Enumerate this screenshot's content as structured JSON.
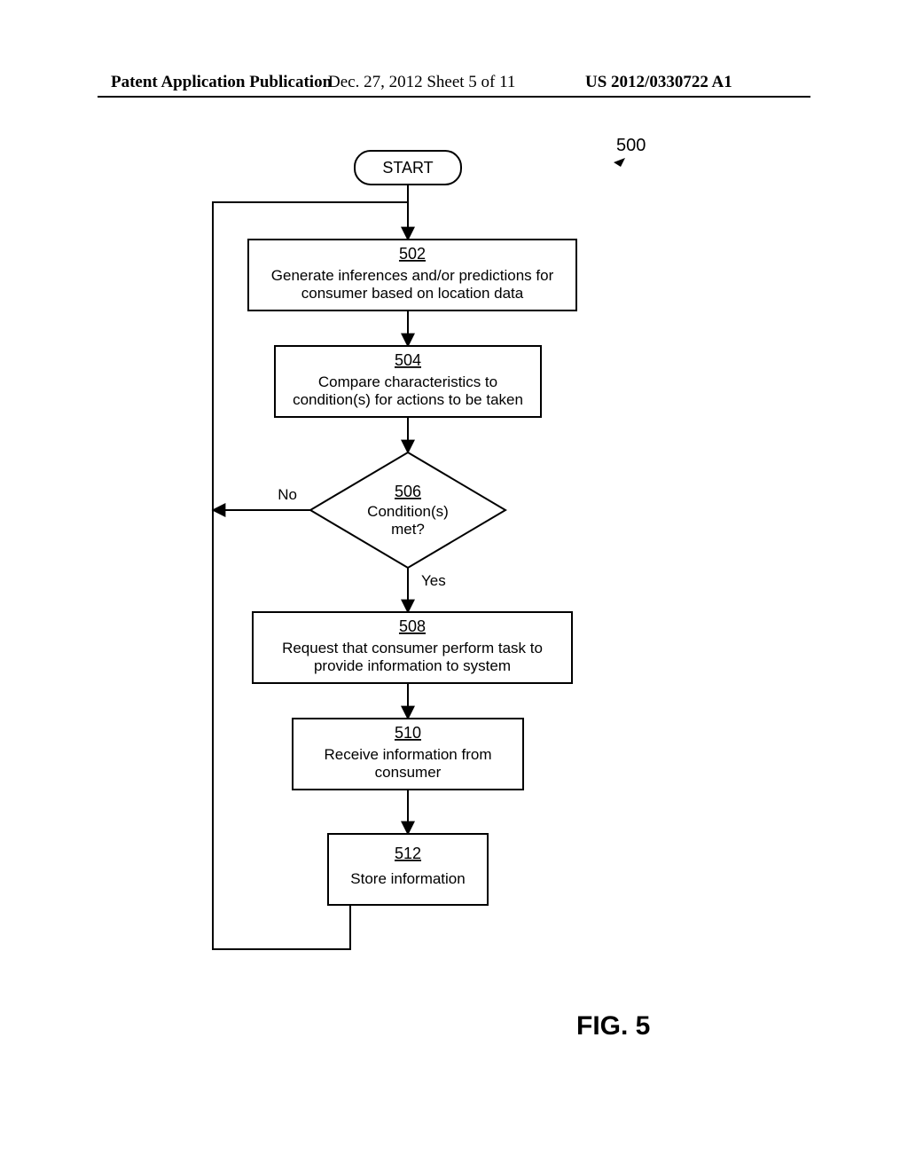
{
  "header": {
    "left": "Patent Application Publication",
    "mid": "Dec. 27, 2012   Sheet 5 of 11",
    "right": "US 2012/0330722 A1"
  },
  "figure": {
    "refnum": "500",
    "caption": "FIG. 5",
    "start": "START",
    "boxes": {
      "b502": {
        "num": "502",
        "l1": "Generate inferences and/or predictions for",
        "l2": "consumer based on location data"
      },
      "b504": {
        "num": "504",
        "l1": "Compare characteristics to",
        "l2": "condition(s) for actions to be taken"
      },
      "b506": {
        "num": "506",
        "l1": "Condition(s)",
        "l2": "met?"
      },
      "b508": {
        "num": "508",
        "l1": "Request that consumer perform task to",
        "l2": "provide information to system"
      },
      "b510": {
        "num": "510",
        "l1": "Receive information from",
        "l2": "consumer"
      },
      "b512": {
        "num": "512",
        "l1": "Store information"
      }
    },
    "labels": {
      "no": "No",
      "yes": "Yes"
    }
  }
}
